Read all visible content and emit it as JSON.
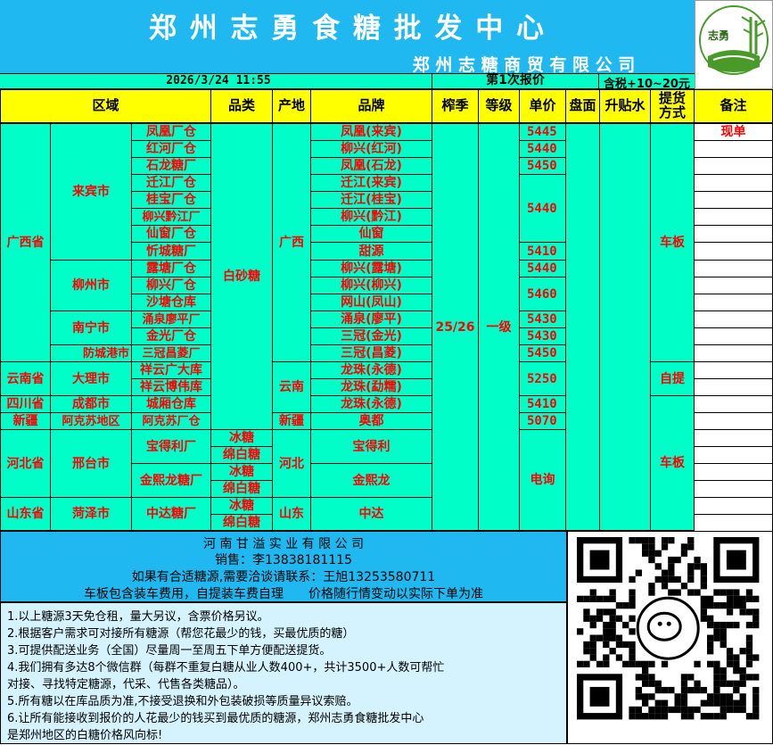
{
  "header": {
    "main_title": "郑 州 志 勇 食 糖 批 发 中 心",
    "subtitle": "郑 州 志 糖 商 贸 有 限 公 司",
    "logo_text": "志勇"
  },
  "info_bar": {
    "datetime": "2026/3/24 11:55",
    "quote_round": "第1次报价",
    "tax_note": "含税+10~20元"
  },
  "columns": {
    "region": "区域",
    "category": "品类",
    "origin": "产地",
    "brand": "品牌",
    "season": "榨季",
    "grade": "等级",
    "price": "单价",
    "market": "盘面",
    "premium": "升贴水",
    "pickup": "提货方式",
    "remark": "备注"
  },
  "provinces": [
    "广西省",
    "云南省",
    "四川省",
    "新疆",
    "河北省",
    "山东省"
  ],
  "cities": [
    "来宾市",
    "柳州市",
    "南宁市",
    "防城港市",
    "大理市",
    "成都市",
    "阿克苏地区",
    "邢台市",
    "菏泽市"
  ],
  "warehouses": [
    "凤凰厂仓",
    "红河厂仓",
    "石龙糖厂",
    "迁江厂仓",
    "桂宝厂仓",
    "柳兴黔江厂",
    "仙窗厂仓",
    "忻城糖厂",
    "露塘厂仓",
    "柳兴厂仓",
    "沙塘仓库",
    "涌泉廖平厂",
    "金光厂仓",
    "三冠昌菱厂",
    "祥云广大库",
    "祥云博伟库",
    "城厢仓库",
    "阿克苏厂仓",
    "宝得利厂",
    "金熙龙糖厂",
    "中达糖厂"
  ],
  "categories": {
    "white": "白砂糖",
    "rock": "冰糖",
    "soft": "绵白糖"
  },
  "origins": [
    "广西",
    "云南",
    "新疆",
    "河北",
    "山东"
  ],
  "brands": [
    "凤凰(来宾)",
    "柳兴(红河)",
    "凤凰(石龙)",
    "迁江(来宾)",
    "迁江(桂宝)",
    "柳兴(黔江)",
    "仙窗",
    "甜源",
    "柳兴(露塘)",
    "柳兴(柳兴)",
    "网山(凤山)",
    "涌泉(廖平)",
    "三冠(金光)",
    "三冠(昌菱)",
    "龙珠(永德)",
    "龙珠(勐糯)",
    "龙珠(永德)",
    "奥都",
    "宝得利",
    "金熙龙",
    "中达"
  ],
  "season": "25/26",
  "grade": "一级",
  "prices": [
    "5445",
    "5440",
    "5450",
    "5440",
    "5410",
    "5440",
    "5460",
    "5430",
    "5430",
    "5450",
    "5250",
    "5410",
    "5070",
    "电询"
  ],
  "pickup": [
    "车板",
    "自提",
    "车板"
  ],
  "remark_first": "现单",
  "contact": {
    "company": "河 南 甘 溢 实 业 有 限 公 司",
    "sales": "销售：李13838181115",
    "cooperation": "如果有合适糖源,需要洽谈请联系：王旭13253580711",
    "shipping": "车板包含装车费用，自提装车费自理　　价格随行情变动以实际下单为准"
  },
  "terms": [
    "1.以上糖源3天免仓租，量大另议，含票价格另议。",
    "2.根据客户需求可对接所有糖源（帮您花最少的钱，买最优质的糖）",
    "3.可提供配送业务（全国）尽量周一至周五下单方便配送提货。",
    "4.我们拥有多达8个微信群（每群不重复白糖从业人数400+，共计3500+人数可帮忙",
    "对接、寻找特定糖源，代采、代售各类糖品）。",
    "5.所有糖以在库品质为准,不接受退换和外包装破损等质量异议索赔。",
    "6.让所有能接收到报价的人花最少的钱买到最优质的糖源，郑州志勇食糖批发中心",
    "是郑州地区的白糖价格风向标!"
  ],
  "colors": {
    "banner": "#1fb8f0",
    "header_yellow": "#ffff00",
    "table_mint": "#00ffc8",
    "text_red": "#ff0000"
  }
}
